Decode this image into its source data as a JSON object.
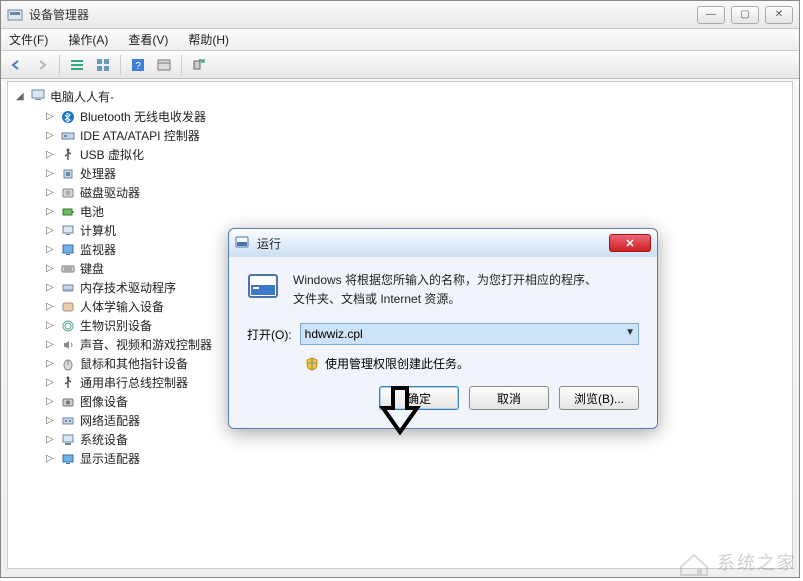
{
  "window": {
    "title": "设备管理器"
  },
  "menu": {
    "file": "文件(F)",
    "action": "操作(A)",
    "view": "查看(V)",
    "help": "帮助(H)"
  },
  "tree": {
    "root": "电脑人人有-",
    "items": [
      {
        "label": "Bluetooth 无线电收发器"
      },
      {
        "label": "IDE ATA/ATAPI 控制器"
      },
      {
        "label": "USB 虚拟化"
      },
      {
        "label": "处理器"
      },
      {
        "label": "磁盘驱动器"
      },
      {
        "label": "电池"
      },
      {
        "label": "计算机"
      },
      {
        "label": "监视器"
      },
      {
        "label": "键盘"
      },
      {
        "label": "内存技术驱动程序"
      },
      {
        "label": "人体学输入设备"
      },
      {
        "label": "生物识别设备"
      },
      {
        "label": "声音、视频和游戏控制器"
      },
      {
        "label": "鼠标和其他指针设备"
      },
      {
        "label": "通用串行总线控制器"
      },
      {
        "label": "图像设备"
      },
      {
        "label": "网络适配器"
      },
      {
        "label": "系统设备"
      },
      {
        "label": "显示适配器"
      }
    ]
  },
  "dialog": {
    "title": "运行",
    "desc_line1": "Windows 将根据您所输入的名称，为您打开相应的程序、",
    "desc_line2": "文件夹、文档或 Internet 资源。",
    "open_label": "打开(O):",
    "open_value": "hdwwiz.cpl",
    "admin_note": "使用管理权限创建此任务。",
    "ok": "确定",
    "cancel": "取消",
    "browse": "浏览(B)..."
  },
  "watermark": "系统之家"
}
